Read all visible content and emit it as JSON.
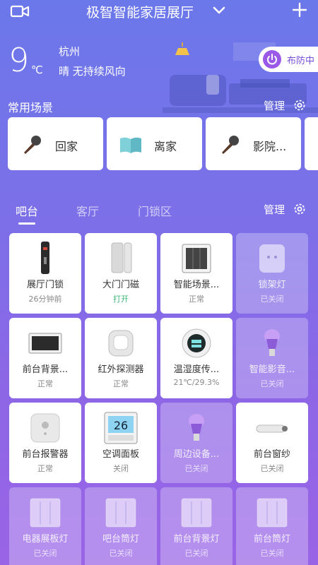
{
  "header": {
    "title": "极智智能家居展厅"
  },
  "weather": {
    "temperature": "9",
    "unit": "℃",
    "city": "杭州",
    "condition": "晴 无持续风向"
  },
  "arm": {
    "label": "布防中"
  },
  "scenes": {
    "title": "常用场景",
    "manage_label": "管理",
    "items": [
      {
        "label": "回家",
        "icon": "microphone-icon"
      },
      {
        "label": "离家",
        "icon": "book-icon"
      },
      {
        "label": "影院...",
        "icon": "microphone-icon"
      }
    ]
  },
  "rooms": {
    "tabs": [
      {
        "label": "吧台",
        "active": true
      },
      {
        "label": "客厅",
        "active": false
      },
      {
        "label": "门锁区",
        "active": false
      }
    ],
    "manage_label": "管理"
  },
  "devices": [
    {
      "name": "展厅门锁",
      "status": "26分钟前",
      "on": true,
      "icon": "door-lock-icon"
    },
    {
      "name": "大门门磁",
      "status": "打开",
      "on": true,
      "icon": "door-sensor-icon",
      "status_color": "#3cb878"
    },
    {
      "name": "智能场景...",
      "status": "正常",
      "on": true,
      "icon": "scene-panel-icon"
    },
    {
      "name": "锁架灯",
      "status": "已关闭",
      "on": false,
      "icon": "smart-plug-icon"
    },
    {
      "name": "前台背景...",
      "status": "正常",
      "on": true,
      "icon": "display-panel-icon"
    },
    {
      "name": "红外探测器",
      "status": "正常",
      "on": true,
      "icon": "infrared-sensor-icon"
    },
    {
      "name": "温湿度传...",
      "status": "21℃/29.3%",
      "on": true,
      "icon": "thermometer-icon"
    },
    {
      "name": "智能影音...",
      "status": "已关闭",
      "on": false,
      "icon": "bulb-icon"
    },
    {
      "name": "前台报警器",
      "status": "正常",
      "on": true,
      "icon": "alarm-icon"
    },
    {
      "name": "空调面板",
      "status": "关闭",
      "on": true,
      "icon": "thermostat-icon"
    },
    {
      "name": "周边设备...",
      "status": "已关闭",
      "on": false,
      "icon": "bulb-icon"
    },
    {
      "name": "前台窗纱",
      "status": "已关闭",
      "on": true,
      "icon": "curtain-motor-icon"
    },
    {
      "name": "电器展板灯",
      "status": "已关闭",
      "on": false,
      "icon": "light-switch-icon"
    },
    {
      "name": "吧台筒灯",
      "status": "已关闭",
      "on": false,
      "icon": "light-switch-icon"
    },
    {
      "name": "前台背景灯",
      "status": "已关闭",
      "on": false,
      "icon": "light-switch-icon"
    },
    {
      "name": "前台筒灯",
      "status": "已关闭",
      "on": false,
      "icon": "light-switch-icon"
    }
  ],
  "thermostat_display": "26"
}
